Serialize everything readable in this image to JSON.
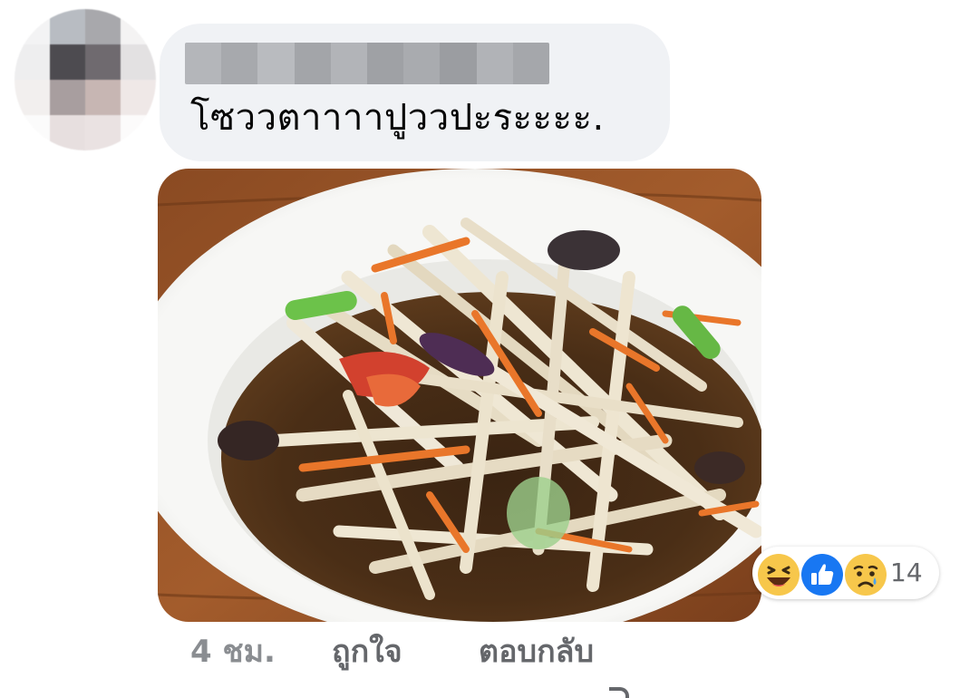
{
  "comment": {
    "author_name_redacted": true,
    "text": "โซววตาาาาปูววปะระะะะ.",
    "attachment": {
      "type": "photo",
      "subject": "papaya-salad"
    }
  },
  "reactions": {
    "icons": [
      "haha-icon",
      "like-icon",
      "sad-icon"
    ],
    "count": "14"
  },
  "actions": {
    "time": "4 ชม.",
    "like_label": "ถูกใจ",
    "reply_label": "ตอบกลับ"
  },
  "colors": {
    "bubble": "#f0f2f5",
    "action_text": "#65676b",
    "like_blue": "#1877f2",
    "emoji_yellow": "#f7c74b"
  }
}
